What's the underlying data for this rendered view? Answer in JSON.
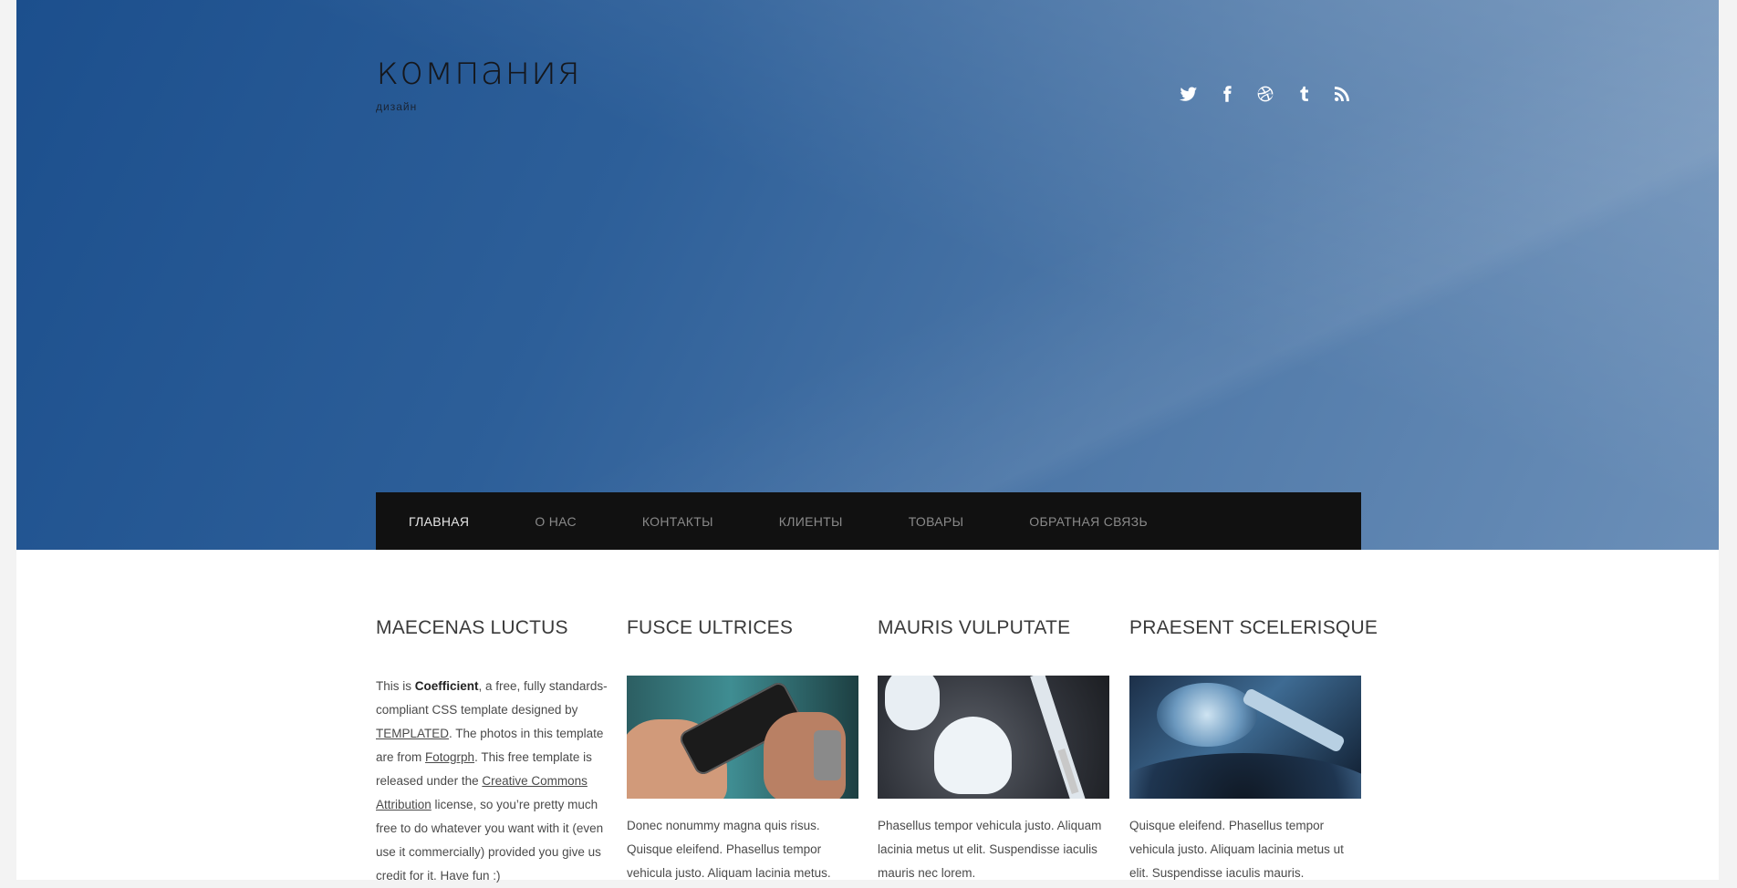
{
  "header": {
    "site_title": "компания",
    "site_subtitle": "дизайн"
  },
  "social": [
    {
      "icon": "twitter-icon"
    },
    {
      "icon": "facebook-icon"
    },
    {
      "icon": "dribbble-icon"
    },
    {
      "icon": "tumblr-icon"
    },
    {
      "icon": "rss-icon"
    }
  ],
  "nav": {
    "items": [
      {
        "label": "ГЛАВНАЯ",
        "active": true
      },
      {
        "label": "О НАС"
      },
      {
        "label": "КОНТАКТЫ"
      },
      {
        "label": "КЛИЕНТЫ"
      },
      {
        "label": "ТОВАРЫ"
      },
      {
        "label": "ОБРАТНАЯ СВЯЗЬ"
      }
    ]
  },
  "columns": [
    {
      "title": "MAECENAS LUCTUS",
      "text_parts": {
        "p1": "This is ",
        "brand": "Coefficient",
        "p2": ", a free, fully standards-compliant CSS template designed by ",
        "link1": "TEMPLATED",
        "p3": ". The photos in this template are from ",
        "link2": "Fotogrph",
        "p4": ". This free template is released under the ",
        "link3": "Creative Commons Attribution",
        "p5": " license, so you’re pretty much free to do whatever you want with it (even use it commercially) provided you give us credit for it. Have fun :)"
      }
    },
    {
      "title": "FUSCE ULTRICES",
      "image": "hands-with-phone",
      "text": "Donec nonummy magna quis risus. Quisque eleifend. Phasellus tempor vehicula justo. Aliquam lacinia metus."
    },
    {
      "title": "MAURIS VULPUTATE",
      "image": "white-earphones",
      "text": "Phasellus tempor vehicula justo. Aliquam lacinia metus ut elit. Suspendisse iaculis mauris nec lorem."
    },
    {
      "title": "PRAESENT SCELERISQUE",
      "image": "hard-drive",
      "text": "Quisque eleifend. Phasellus tempor vehicula justo. Aliquam lacinia metus ut elit. Suspendisse iaculis mauris."
    }
  ]
}
